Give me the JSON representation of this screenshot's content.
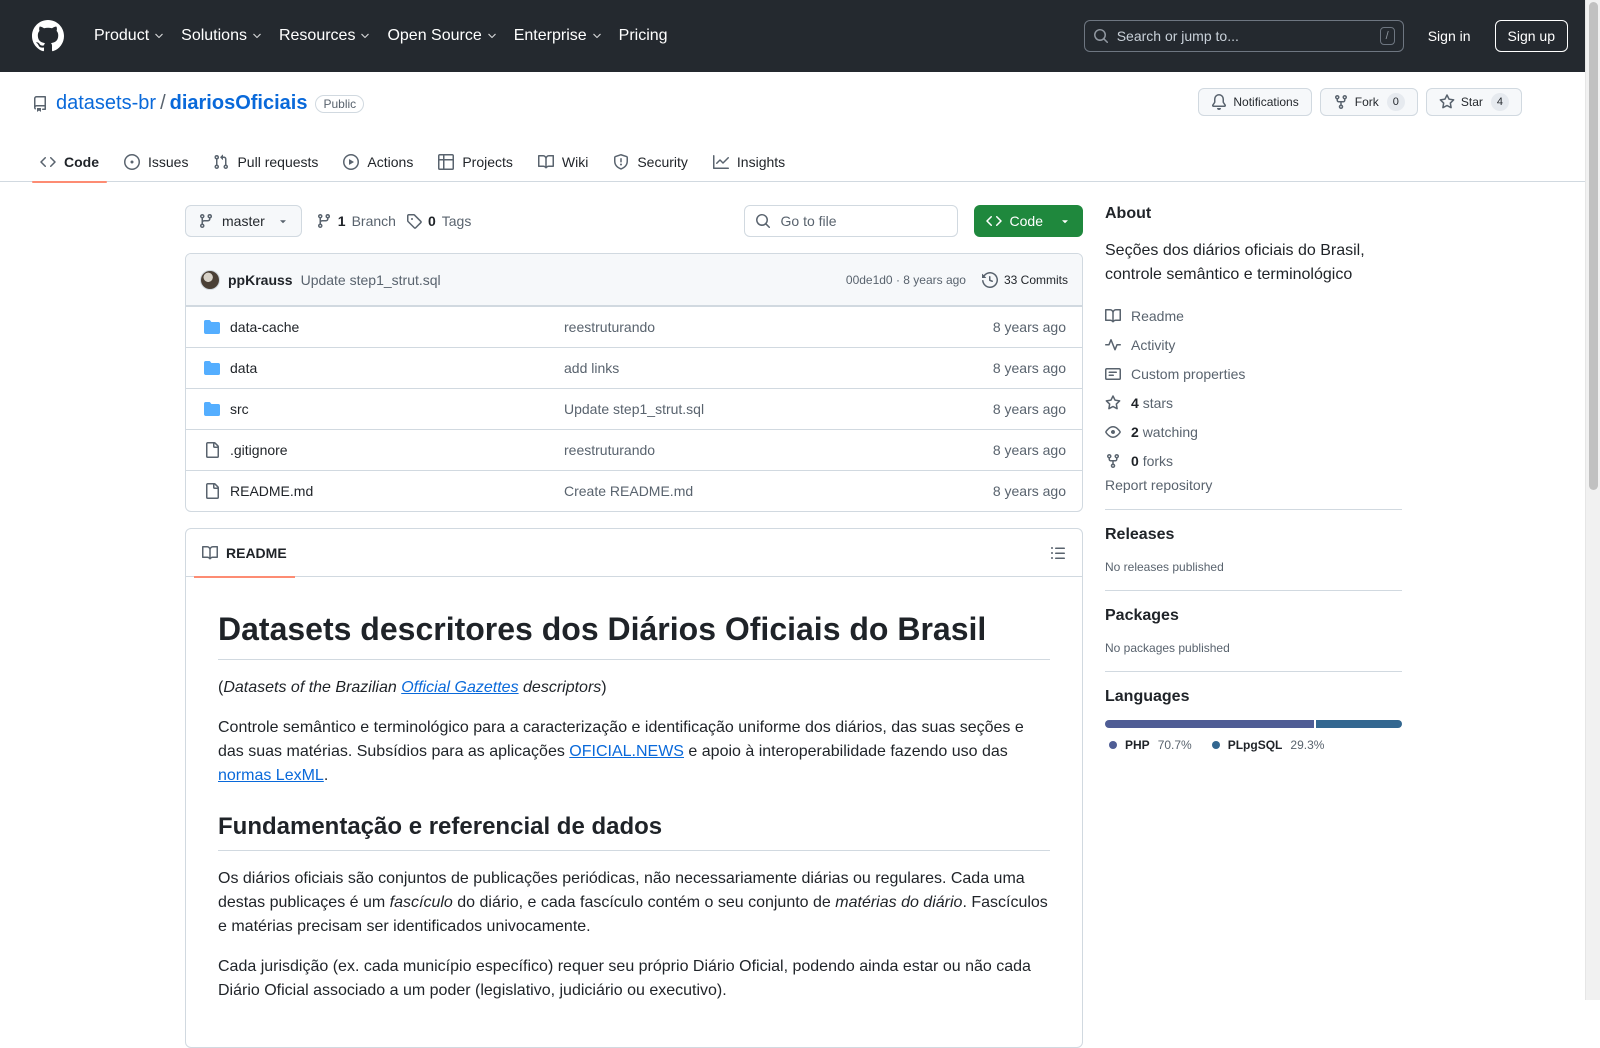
{
  "header": {
    "nav": [
      "Product",
      "Solutions",
      "Resources",
      "Open Source",
      "Enterprise",
      "Pricing"
    ],
    "search_placeholder": "Search or jump to...",
    "search_shortcut": "/",
    "sign_in": "Sign in",
    "sign_up": "Sign up"
  },
  "repo": {
    "owner": "datasets-br",
    "separator": "/",
    "name": "diariosOficiais",
    "visibility": "Public",
    "notifications_label": "Notifications",
    "fork_label": "Fork",
    "fork_count": "0",
    "star_label": "Star",
    "star_count": "4"
  },
  "tabs": [
    {
      "label": "Code",
      "icon": "code-icon",
      "active": true
    },
    {
      "label": "Issues",
      "icon": "issue-icon"
    },
    {
      "label": "Pull requests",
      "icon": "pull-request-icon"
    },
    {
      "label": "Actions",
      "icon": "play-icon"
    },
    {
      "label": "Projects",
      "icon": "table-icon"
    },
    {
      "label": "Wiki",
      "icon": "book-icon"
    },
    {
      "label": "Security",
      "icon": "shield-icon"
    },
    {
      "label": "Insights",
      "icon": "graph-icon"
    }
  ],
  "toolbar": {
    "branch": "master",
    "branch_count": "1",
    "branch_label": "Branch",
    "tag_count": "0",
    "tag_label": "Tags",
    "goto_placeholder": "Go to file",
    "code_button": "Code"
  },
  "commit": {
    "author": "ppKrauss",
    "message": "Update step1_strut.sql",
    "sha_age": "00de1d0 · 8 years ago",
    "commits_label": "33 Commits"
  },
  "files": [
    {
      "type": "folder",
      "name": "data-cache",
      "message": "reestruturando",
      "age": "8 years ago"
    },
    {
      "type": "folder",
      "name": "data",
      "message": "add links",
      "age": "8 years ago"
    },
    {
      "type": "folder",
      "name": "src",
      "message": "Update step1_strut.sql",
      "age": "8 years ago"
    },
    {
      "type": "file",
      "name": ".gitignore",
      "message": "reestruturando",
      "age": "8 years ago"
    },
    {
      "type": "file",
      "name": "README.md",
      "message": "Create README.md",
      "age": "8 years ago"
    }
  ],
  "readme": {
    "tab_label": "README",
    "h1": "Datasets descritores dos Diários Oficiais do Brasil",
    "p1_open": "(",
    "p1_em1": "Datasets of the Brazilian ",
    "p1_link": "Official Gazettes",
    "p1_em2": " descriptors",
    "p1_close": ")",
    "p2_a": "Controle semântico e terminológico para a caracterização e identificação uniforme dos diários, das suas seções e das suas matérias. Subsídios para as aplicações ",
    "p2_link1": "OFICIAL.NEWS",
    "p2_b": " e apoio à interoperabilidade fazendo uso das ",
    "p2_link2": "normas LexML",
    "p2_c": ".",
    "h2": "Fundamentação e referencial de dados",
    "p3_a": "Os diários oficiais são conjuntos de publicações periódicas, não necessariamente diárias ou regulares. Cada uma destas publicaçes é um ",
    "p3_em1": "fascículo",
    "p3_b": " do diário, e cada fascículo contém o seu conjunto de ",
    "p3_em2": "matérias do diário",
    "p3_c": ". Fascículos e matérias precisam ser identificados univocamente.",
    "p4": "Cada jurisdição (ex. cada município específico) requer seu próprio Diário Oficial, podendo ainda estar ou não cada Diário Oficial associado a um poder (legislativo, judiciário ou executivo)."
  },
  "about": {
    "title": "About",
    "description": "Seções dos diários oficiais do Brasil, controle semântico e terminológico",
    "readme": "Readme",
    "activity": "Activity",
    "custom_properties": "Custom properties",
    "stars_count": "4",
    "stars_label": "stars",
    "watching_count": "2",
    "watching_label": "watching",
    "forks_count": "0",
    "forks_label": "forks",
    "report": "Report repository"
  },
  "releases": {
    "title": "Releases",
    "empty": "No releases published"
  },
  "packages": {
    "title": "Packages",
    "empty": "No packages published"
  },
  "languages": {
    "title": "Languages",
    "items": [
      {
        "name": "PHP",
        "percent": "70.7%",
        "value": 70.7,
        "color": "#4F5D95"
      },
      {
        "name": "PLpgSQL",
        "percent": "29.3%",
        "value": 29.3,
        "color": "#336790"
      }
    ]
  }
}
